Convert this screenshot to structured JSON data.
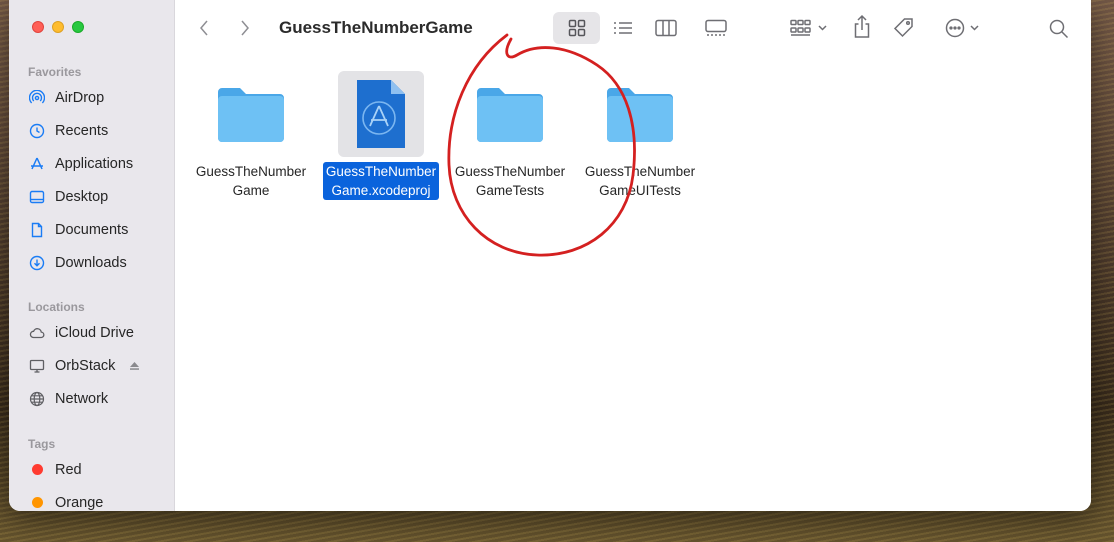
{
  "window": {
    "title": "GuessTheNumberGame"
  },
  "sidebar": {
    "favorites_header": "Favorites",
    "favorites": [
      {
        "label": "AirDrop",
        "icon": "airdrop-icon"
      },
      {
        "label": "Recents",
        "icon": "clock-icon"
      },
      {
        "label": "Applications",
        "icon": "applications-icon"
      },
      {
        "label": "Desktop",
        "icon": "desktop-icon"
      },
      {
        "label": "Documents",
        "icon": "document-icon"
      },
      {
        "label": "Downloads",
        "icon": "download-icon"
      }
    ],
    "locations_header": "Locations",
    "locations": [
      {
        "label": "iCloud Drive",
        "icon": "cloud-icon"
      },
      {
        "label": "OrbStack",
        "icon": "display-icon"
      },
      {
        "label": "Network",
        "icon": "globe-icon"
      }
    ],
    "tags_header": "Tags",
    "tags": [
      {
        "label": "Red",
        "color": "#ff3b30"
      },
      {
        "label": "Orange",
        "color": "#ff9500"
      }
    ]
  },
  "files": [
    {
      "line1": "GuessTheNumber",
      "line2": "Game",
      "type": "folder",
      "selected": false
    },
    {
      "line1": "GuessTheNumber",
      "line2": "Game.xcodeproj",
      "type": "xcodeproj",
      "selected": true
    },
    {
      "line1": "GuessTheNumber",
      "line2": "GameTests",
      "type": "folder",
      "selected": false
    },
    {
      "line1": "GuessTheNumber",
      "line2": "GameUITests",
      "type": "folder",
      "selected": false
    }
  ],
  "colors": {
    "selection": "#0a63dc",
    "folder": "#5ab4f0",
    "annotation": "#d42020"
  }
}
